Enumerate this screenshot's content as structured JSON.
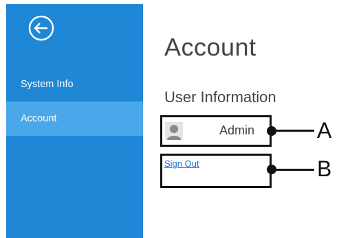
{
  "sidebar": {
    "back_icon": "back-arrow-circle-icon",
    "items": [
      {
        "label": "System Info",
        "selected": false
      },
      {
        "label": "Account",
        "selected": true
      }
    ]
  },
  "main": {
    "title": "Account",
    "section_heading": "User Information",
    "user": {
      "name": "Admin",
      "avatar_icon": "user-avatar-icon"
    },
    "sign_out_label": "Sign Out"
  },
  "callouts": [
    {
      "label": "A"
    },
    {
      "label": "B"
    }
  ],
  "colors": {
    "sidebar_bg": "#1e88d6",
    "selected_item_bg": "#4aa7ea",
    "link": "#1c6fd1"
  }
}
